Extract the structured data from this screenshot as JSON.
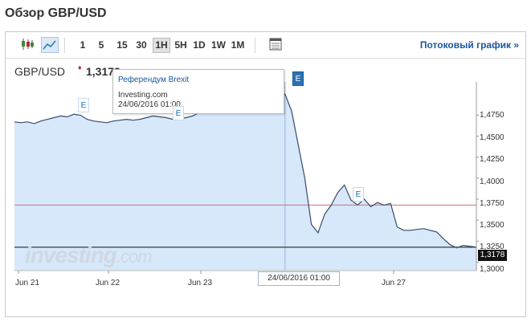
{
  "page_title": "Обзор GBP/USD",
  "toolbar": {
    "intervals": [
      "1",
      "5",
      "15",
      "30",
      "1H",
      "5H",
      "1D",
      "1W",
      "1M"
    ],
    "active_interval": "1H",
    "stream_link": "Потоковый график »"
  },
  "symbol": "GBP/USD",
  "current_price": "1,3178",
  "tooltip": {
    "title": "Референдум Brexit",
    "source": "Investing.com",
    "datetime": "24/06/2016 01:00"
  },
  "crosshair_date": "24/06/2016 01:00",
  "watermark": {
    "brand": "investing",
    "suffix": ".com"
  },
  "event_marker_label": "E",
  "colors": {
    "line": "#3a4a6b",
    "area": "#d6e8fa",
    "reference_line": "#d07070",
    "link": "#1a56a0"
  },
  "chart_data": {
    "type": "area",
    "x_labels": [
      "Jun 21",
      "Jun 22",
      "Jun 23",
      "Jun 27"
    ],
    "y_ticks": [
      "1,4750",
      "1,4500",
      "1,4250",
      "1,4000",
      "1,3750",
      "1,3500",
      "1,3250",
      "1,3000"
    ],
    "ylim": [
      1.29,
      1.505
    ],
    "reference_level": 1.368,
    "last_price": 1.3178,
    "series": [
      {
        "values": [
          1.467,
          1.466,
          1.467,
          1.465,
          1.468,
          1.47,
          1.472,
          1.474,
          1.473,
          1.476,
          1.475,
          1.47,
          1.468,
          1.467,
          1.466,
          1.468,
          1.469,
          1.47,
          1.469,
          1.47,
          1.472,
          1.474,
          1.473,
          1.472,
          1.47,
          1.471,
          1.472,
          1.474,
          1.478,
          1.485,
          1.49,
          1.487,
          1.484,
          1.48,
          1.477,
          1.478,
          1.48,
          1.483,
          1.485,
          1.49,
          1.494,
          1.5,
          1.48,
          1.44,
          1.4,
          1.345,
          1.335,
          1.357,
          1.368,
          1.383,
          1.392,
          1.374,
          1.368,
          1.375,
          1.366,
          1.371,
          1.368,
          1.37,
          1.342,
          1.338,
          1.338,
          1.339,
          1.34,
          1.338,
          1.336,
          1.328,
          1.321,
          1.317,
          1.32,
          1.319,
          1.318
        ]
      }
    ],
    "grid": false
  }
}
